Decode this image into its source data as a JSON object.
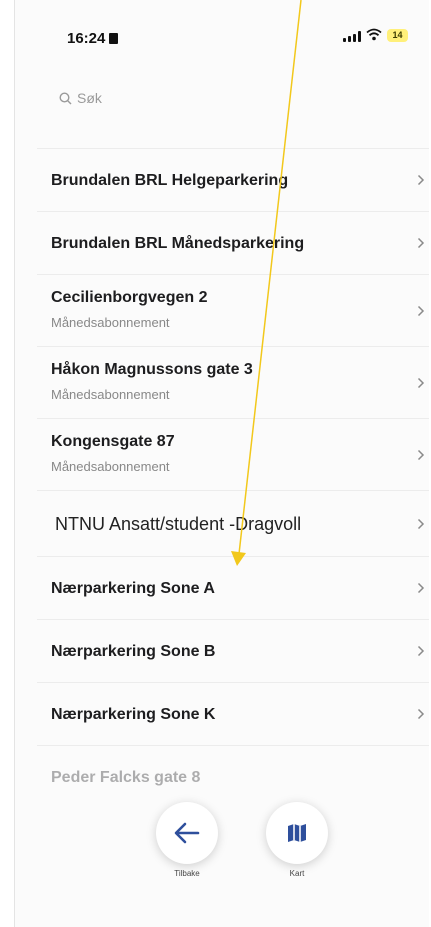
{
  "status_bar": {
    "time": "16:24",
    "battery": "14",
    "battery_color": "#fff07a"
  },
  "search": {
    "placeholder": "Søk",
    "icon": "search-icon"
  },
  "list": {
    "items": [
      {
        "title": "Brundalen BRL Helgeparkering",
        "subtitle": ""
      },
      {
        "title": "Brundalen BRL Månedsparkering",
        "subtitle": ""
      },
      {
        "title": "Cecilienborgvegen 2",
        "subtitle": "Månedsabonnement"
      },
      {
        "title": "Håkon Magnussons gate 3",
        "subtitle": "Månedsabonnement"
      },
      {
        "title": "Kongensgate 87",
        "subtitle": "Månedsabonnement"
      },
      {
        "title": "NTNU Ansatt/student -Dragvoll",
        "subtitle": ""
      },
      {
        "title": "Nærparkering Sone A",
        "subtitle": ""
      },
      {
        "title": "Nærparkering Sone B",
        "subtitle": ""
      },
      {
        "title": "Nærparkering Sone K",
        "subtitle": ""
      },
      {
        "title": "Peder Falcks gate 8",
        "subtitle": ""
      }
    ]
  },
  "bottom_actions": {
    "back_label": "Tilbake",
    "back_icon": "arrow-left-icon",
    "map_label": "Kart",
    "map_icon": "map-icon"
  },
  "annotation": {
    "color": "#f2c81b"
  }
}
